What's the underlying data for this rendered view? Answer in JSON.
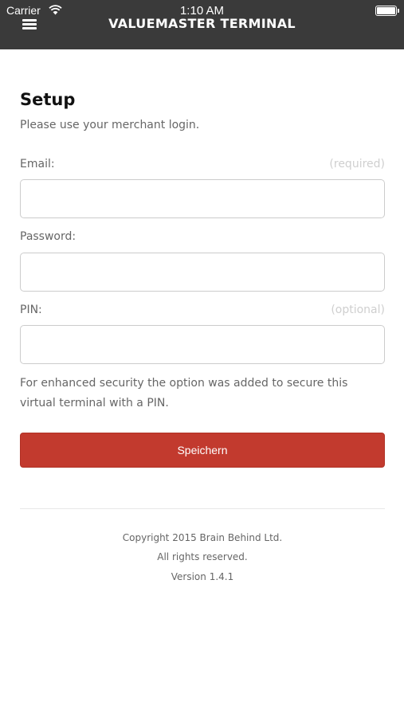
{
  "status_bar": {
    "carrier": "Carrier",
    "time": "1:10 AM"
  },
  "header": {
    "title": "VALUEMASTER TERMINAL",
    "background": "#3a3a3a"
  },
  "setup": {
    "title": "Setup",
    "subtitle": "Please use your merchant login."
  },
  "form": {
    "email": {
      "label": "Email:",
      "hint": "(required)",
      "value": ""
    },
    "password": {
      "label": "Password:",
      "value": ""
    },
    "pin": {
      "label": "PIN:",
      "hint": "(optional)",
      "value": ""
    },
    "security_note": "For enhanced security the option was added to secure this virtual terminal with a PIN.",
    "save_label": "Speichern"
  },
  "footer": {
    "copyright": "Copyright 2015 Brain Behind Ltd.",
    "rights": "All rights reserved.",
    "version": "Version 1.4.1"
  },
  "colors": {
    "accent": "#c23a2e",
    "header_bg": "#3a3a3a"
  }
}
